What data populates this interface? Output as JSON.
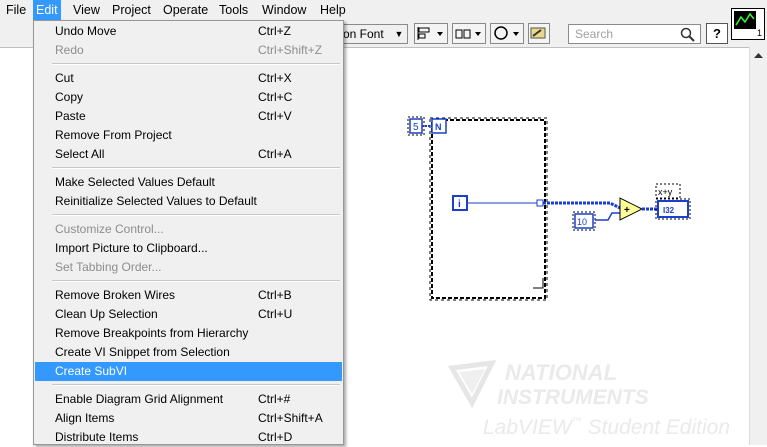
{
  "menubar": {
    "items": [
      "File",
      "Edit",
      "View",
      "Project",
      "Operate",
      "Tools",
      "Window",
      "Help"
    ]
  },
  "toolbar": {
    "font_label": "on Font",
    "search_placeholder": "Search",
    "help_label": "?"
  },
  "edit_menu": {
    "undo": {
      "label": "Undo Move",
      "shortcut": "Ctrl+Z"
    },
    "redo": {
      "label": "Redo",
      "shortcut": "Ctrl+Shift+Z"
    },
    "cut": {
      "label": "Cut",
      "shortcut": "Ctrl+X"
    },
    "copy": {
      "label": "Copy",
      "shortcut": "Ctrl+C"
    },
    "paste": {
      "label": "Paste",
      "shortcut": "Ctrl+V"
    },
    "remove_from_project": {
      "label": "Remove From Project"
    },
    "select_all": {
      "label": "Select All",
      "shortcut": "Ctrl+A"
    },
    "make_default": {
      "label": "Make Selected Values Default"
    },
    "reinit_default": {
      "label": "Reinitialize Selected Values to Default"
    },
    "customize_control": {
      "label": "Customize Control..."
    },
    "import_picture": {
      "label": "Import Picture to Clipboard..."
    },
    "set_tabbing": {
      "label": "Set Tabbing Order..."
    },
    "remove_broken_wires": {
      "label": "Remove Broken Wires",
      "shortcut": "Ctrl+B"
    },
    "clean_up_selection": {
      "label": "Clean Up Selection",
      "shortcut": "Ctrl+U"
    },
    "remove_breakpoints": {
      "label": "Remove Breakpoints from Hierarchy"
    },
    "create_vi_snippet": {
      "label": "Create VI Snippet from Selection"
    },
    "create_subvi": {
      "label": "Create SubVI"
    },
    "grid_alignment": {
      "label": "Enable Diagram Grid Alignment",
      "shortcut": "Ctrl+#"
    },
    "align_items": {
      "label": "Align Items",
      "shortcut": "Ctrl+Shift+A"
    },
    "distribute_items": {
      "label": "Distribute Items",
      "shortcut": "Ctrl+D"
    }
  },
  "diagram": {
    "loop_count_constant": "5",
    "loop_count_terminal": "N",
    "iteration_terminal": "i",
    "numeric_constant": "10",
    "add_function": "+",
    "x_plus_y_label": "x+y",
    "indicator_type": "I32"
  },
  "watermark": {
    "line1": "NATIONAL",
    "line2": "INSTRUMENTS",
    "line3": "LabVIEW",
    "tm": "™",
    "line4": "Student Edition"
  },
  "colors": {
    "menu_highlight": "#3399ff",
    "wire_blue": "#1a3fcc",
    "menu_background": "#f0f0f0"
  }
}
